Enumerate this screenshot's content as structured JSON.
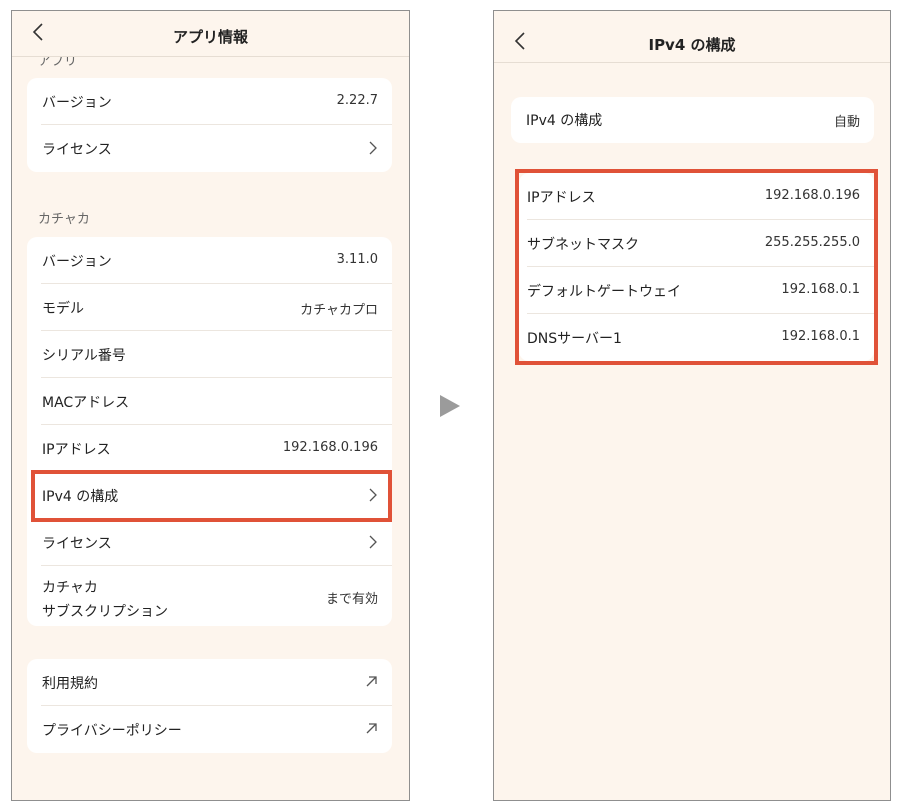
{
  "left_screen": {
    "title": "アプリ情報",
    "partial_section_label": "アプリ",
    "app_card": {
      "rows": [
        {
          "label": "バージョン",
          "value": "2.22.7"
        },
        {
          "label": "ライセンス",
          "value": ""
        }
      ]
    },
    "device_section_label": "カチャカ",
    "device_card": {
      "rows": [
        {
          "label": "バージョン",
          "value": "3.11.0"
        },
        {
          "label": "モデル",
          "value": "カチャカプロ"
        },
        {
          "label": "シリアル番号",
          "value": ""
        },
        {
          "label": "MACアドレス",
          "value": ""
        },
        {
          "label": "IPアドレス",
          "value": "192.168.0.196"
        },
        {
          "label": "IPv4 の構成",
          "value": ""
        },
        {
          "label": "ライセンス",
          "value": ""
        },
        {
          "label_line1": "カチャカ",
          "label_line2": "サブスクリプション",
          "value": "まで有効"
        }
      ]
    },
    "links_card": {
      "rows": [
        {
          "label": "利用規約"
        },
        {
          "label": "プライバシーポリシー"
        }
      ]
    }
  },
  "right_screen": {
    "title": "IPv4 の構成",
    "config_card": {
      "label": "IPv4 の構成",
      "value": "自動"
    },
    "details_card": {
      "rows": [
        {
          "label": "IPアドレス",
          "value": "192.168.0.196"
        },
        {
          "label": "サブネットマスク",
          "value": "255.255.255.0"
        },
        {
          "label": "デフォルトゲートウェイ",
          "value": "192.168.0.1"
        },
        {
          "label": "DNSサーバー1",
          "value": "192.168.0.1"
        }
      ]
    }
  },
  "colors": {
    "background": "#fdf5ed",
    "card": "#ffffff",
    "highlight": "#e05238",
    "arrow": "#9b9b9b"
  },
  "icons": {
    "back": "chevron-left-icon",
    "row_nav": "chevron-right-icon",
    "external": "external-link-icon",
    "transition": "play-arrow-icon"
  }
}
